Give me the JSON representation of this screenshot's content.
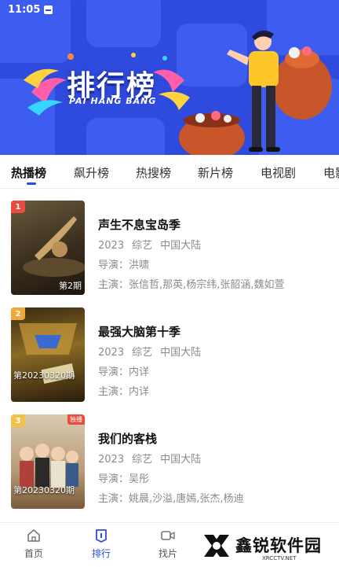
{
  "status_bar": {
    "time": "11:05"
  },
  "banner": {
    "title": "排行榜",
    "subtitle": "PAI HANG BANG"
  },
  "tabs": [
    {
      "label": "热播榜",
      "active": true
    },
    {
      "label": "飙升榜"
    },
    {
      "label": "热搜榜"
    },
    {
      "label": "新片榜"
    },
    {
      "label": "电视剧"
    },
    {
      "label": "电影"
    }
  ],
  "items": [
    {
      "rank": "1",
      "rank_color": "#e84c3d",
      "title": "声生不息宝岛季",
      "year": "2023",
      "genre": "综艺",
      "region": "中国大陆",
      "director": "导演：洪啸",
      "cast": "主演：张信哲,那英,杨宗纬,张韶涵,魏如萱",
      "poster_caption": "第2期",
      "poster_tag": ""
    },
    {
      "rank": "2",
      "rank_color": "#f2a93b",
      "title": "最强大脑第十季",
      "year": "2023",
      "genre": "综艺",
      "region": "中国大陆",
      "director": "导演：内详",
      "cast": "主演：内详",
      "poster_caption": "第20230320期",
      "poster_tag": ""
    },
    {
      "rank": "3",
      "rank_color": "#f0c24b",
      "title": "我们的客栈",
      "year": "2023",
      "genre": "综艺",
      "region": "中国大陆",
      "director": "导演：吴彤",
      "cast": "主演：姚晨,沙溢,唐嫣,张杰,杨迪",
      "poster_caption": "第20230320期",
      "poster_tag": "独播"
    }
  ],
  "bottom_nav": [
    {
      "label": "首页",
      "icon": "home-icon"
    },
    {
      "label": "排行",
      "icon": "ranking-icon",
      "active": true
    },
    {
      "label": "找片",
      "icon": "video-icon"
    }
  ],
  "watermark": {
    "text": "鑫锐软件园",
    "url": "XRCCTV.NET"
  },
  "colors": {
    "accent": "#2f4bde",
    "banner_bg": "#2f4bde"
  }
}
